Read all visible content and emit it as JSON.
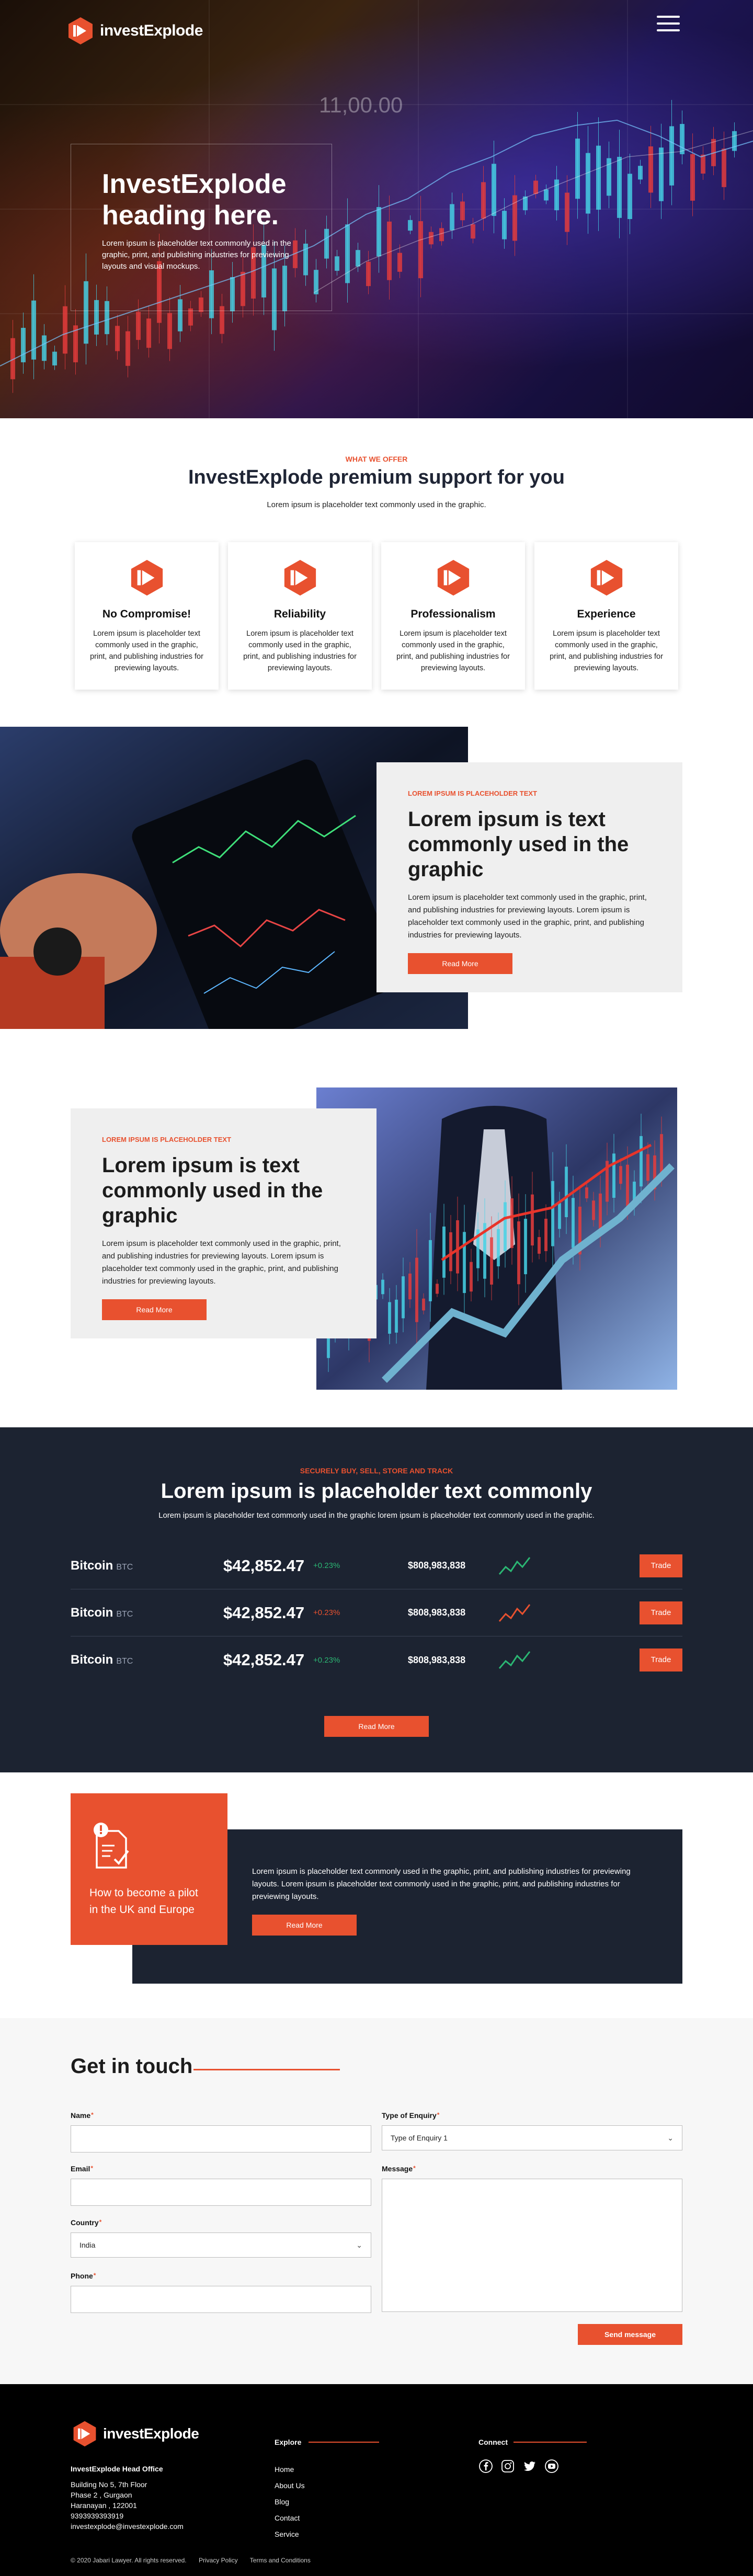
{
  "brand": {
    "name": "investExplode",
    "color": "#e8512f",
    "dark": "#1c2331"
  },
  "hero": {
    "title": "InvestExplode heading here.",
    "text": "Lorem ipsum is placeholder text commonly used in the graphic, print, and publishing industries for previewing layouts and visual mockups.",
    "chart_number": "11,00.00"
  },
  "offer": {
    "eyebrow": "WHAT WE OFFER",
    "title": "InvestExplode premium support for you",
    "subtitle": "Lorem ipsum is placeholder text commonly used in the graphic.",
    "cards": [
      {
        "title": "No Compromise!",
        "text": "Lorem ipsum is placeholder text commonly used in the graphic, print, and publishing industries for previewing layouts.",
        "icon": "brand-logo-icon"
      },
      {
        "title": "Reliability",
        "text": "Lorem ipsum is placeholder text commonly used in the graphic, print, and publishing industries for previewing layouts.",
        "icon": "brand-logo-icon"
      },
      {
        "title": "Professionalism",
        "text": "Lorem ipsum is placeholder text commonly used in the graphic, print, and publishing industries for previewing layouts.",
        "icon": "brand-logo-icon"
      },
      {
        "title": "Experience",
        "text": "Lorem ipsum is placeholder text commonly used in the graphic, print, and publishing industries for previewing layouts.",
        "icon": "brand-logo-icon"
      }
    ]
  },
  "feature1": {
    "eyebrow": "LOREM IPSUM IS PLACEHOLDER TEXT",
    "title": "Lorem ipsum is text commonly used in the graphic",
    "text": "Lorem ipsum is placeholder text commonly used in the graphic, print, and publishing industries for previewing layouts. Lorem ipsum is placeholder text commonly used in the graphic, print, and publishing industries for previewing layouts.",
    "button": "Read More"
  },
  "feature2": {
    "eyebrow": "LOREM IPSUM IS PLACEHOLDER TEXT",
    "title": "Lorem ipsum is text commonly used in the graphic",
    "text": "Lorem ipsum is placeholder text commonly used in the graphic, print, and publishing industries for previewing layouts. Lorem ipsum is placeholder text commonly used in the graphic, print, and publishing industries for previewing layouts.",
    "button": "Read More"
  },
  "trade": {
    "eyebrow": "SECURELY BUY, SELL, STORE AND TRACK",
    "title": "Lorem ipsum is placeholder text commonly",
    "subtitle": "Lorem ipsum is placeholder text commonly used in the graphic lorem ipsum is placeholder text commonly used in the graphic.",
    "rows": [
      {
        "coin": "Bitcoin",
        "symbol": "BTC",
        "price": "$42,852.47",
        "change": "+0.23%",
        "direction": "up",
        "volume": "$808,983,838",
        "button": "Trade"
      },
      {
        "coin": "Bitcoin",
        "symbol": "BTC",
        "price": "$42,852.47",
        "change": "+0.23%",
        "direction": "down",
        "volume": "$808,983,838",
        "button": "Trade"
      },
      {
        "coin": "Bitcoin",
        "symbol": "BTC",
        "price": "$42,852.47",
        "change": "+0.23%",
        "direction": "up",
        "volume": "$808,983,838",
        "button": "Trade"
      }
    ],
    "button": "Read More",
    "up_color": "#2bb673",
    "down_color": "#e8512f"
  },
  "pilot": {
    "title": "How to become a pilot in the UK and Europe",
    "text": "Lorem ipsum is placeholder text commonly used in the graphic, print, and publishing industries for previewing layouts. Lorem ipsum is placeholder text commonly used in the graphic, print, and publishing industries for previewing layouts.",
    "button": "Read More"
  },
  "contact": {
    "title": "Get in touch",
    "name_label": "Name",
    "email_label": "Email",
    "country_label": "Country",
    "country_value": "India",
    "phone_label": "Phone",
    "enquiry_label": "Type of Enquiry",
    "enquiry_value": "Type of Enquiry 1",
    "message_label": "Message",
    "required_mark": "*",
    "submit": "Send message"
  },
  "footer": {
    "office_title": "InvestExplode Head Office",
    "address": [
      "Building No 5, 7th Floor",
      "Phase 2 , Gurgaon",
      "Haranayan , 122001",
      "9393939393919",
      "investexplode@investexplode.com"
    ],
    "explore_title": "Explore",
    "links": [
      "Home",
      "About Us",
      "Blog",
      "Contact",
      "Service"
    ],
    "connect_title": "Connect",
    "social": [
      "facebook-icon",
      "instagram-icon",
      "twitter-icon",
      "youtube-icon"
    ],
    "copyright": "© 2020 Jabari Lawyer. All rights reserved.",
    "privacy": "Privacy Policy",
    "terms": "Terms and Conditions"
  }
}
